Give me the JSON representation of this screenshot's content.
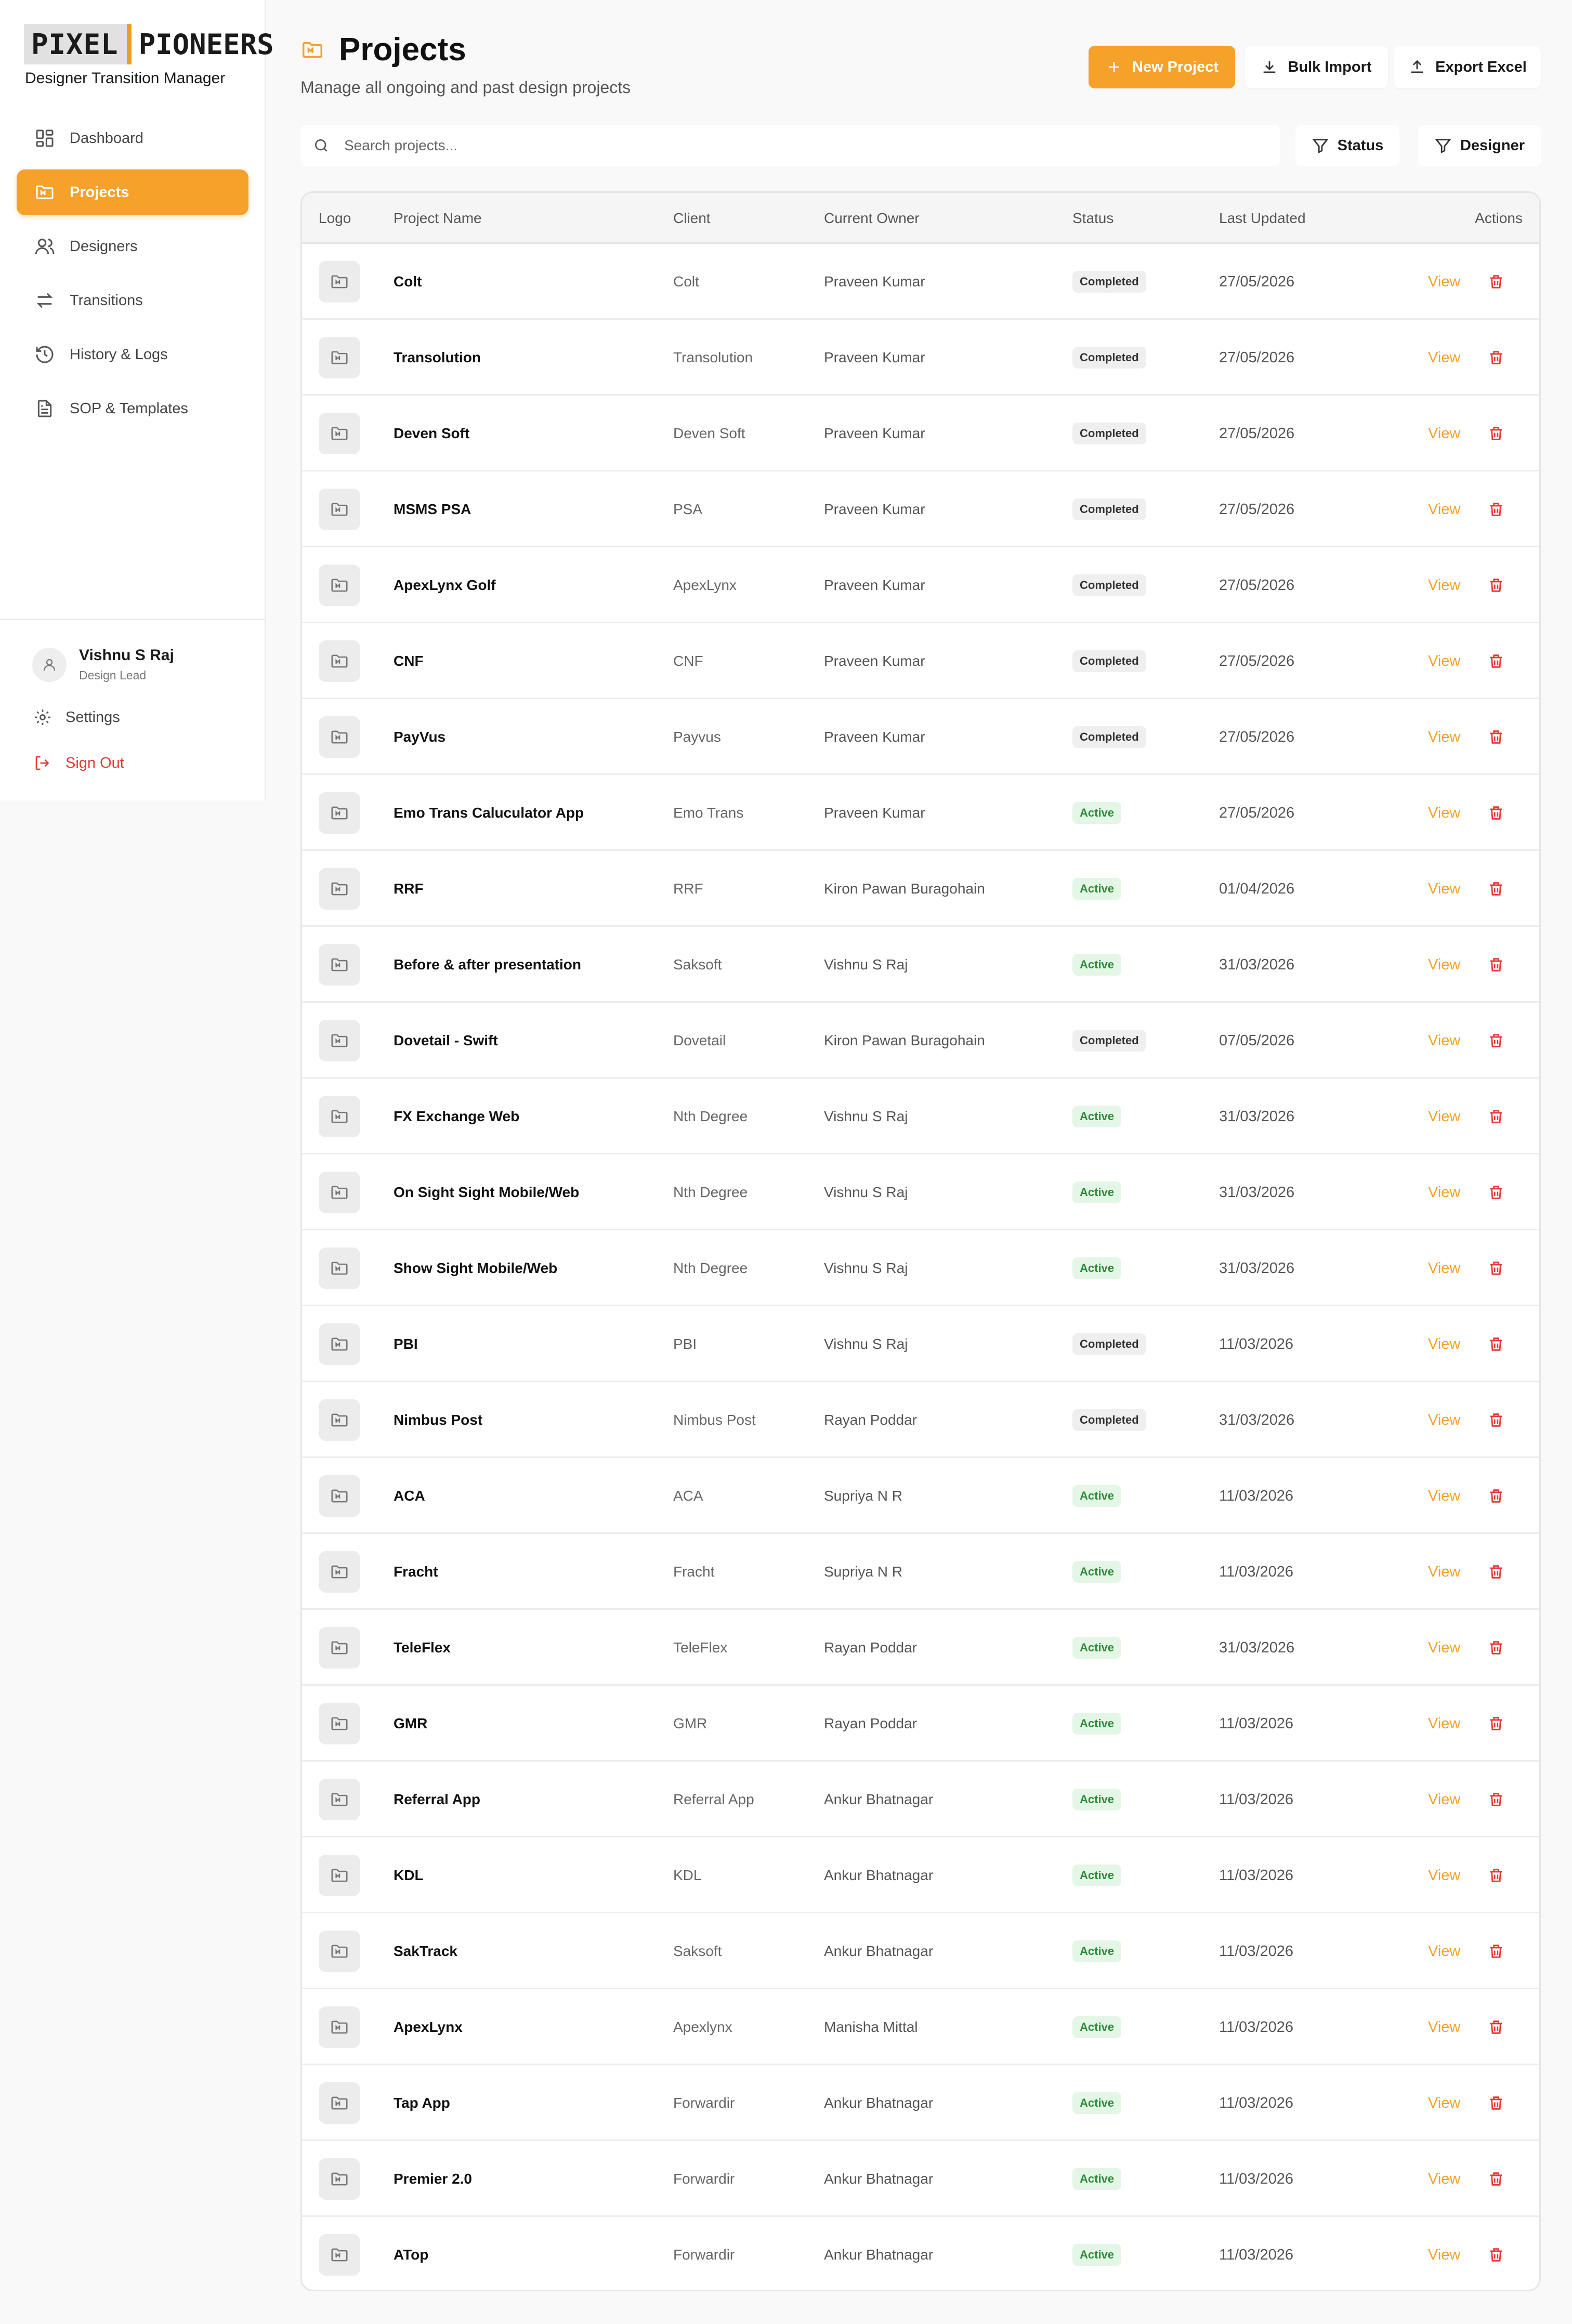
{
  "brand": {
    "logo_part1": "PIXEL",
    "logo_part2": "PIONEERS",
    "app_subtitle": "Designer Transition Manager",
    "accent": "#f5a12a"
  },
  "sidebar": {
    "items": [
      {
        "label": "Dashboard",
        "icon": "dashboard-icon",
        "active": false
      },
      {
        "label": "Projects",
        "icon": "folder-icon",
        "active": true
      },
      {
        "label": "Designers",
        "icon": "users-icon",
        "active": false
      },
      {
        "label": "Transitions",
        "icon": "arrows-icon",
        "active": false
      },
      {
        "label": "History & Logs",
        "icon": "history-icon",
        "active": false
      },
      {
        "label": "SOP & Templates",
        "icon": "document-icon",
        "active": false
      }
    ],
    "user": {
      "name": "Vishnu S Raj",
      "role": "Design Lead"
    },
    "settings_label": "Settings",
    "signout_label": "Sign Out"
  },
  "header": {
    "title": "Projects",
    "subtitle": "Manage all ongoing and past design projects",
    "new_project": "New Project",
    "bulk_import": "Bulk Import",
    "export_excel": "Export Excel"
  },
  "search": {
    "placeholder": "Search projects..."
  },
  "filters": {
    "status": "Status",
    "designer": "Designer"
  },
  "table": {
    "columns": [
      "Logo",
      "Project Name",
      "Client",
      "Current Owner",
      "Status",
      "Last Updated",
      "Actions"
    ],
    "view_label": "View",
    "rows": [
      {
        "name": "Colt",
        "client": "Colt",
        "owner": "Praveen Kumar",
        "status": "Completed",
        "updated": "27/05/2026"
      },
      {
        "name": "Transolution",
        "client": "Transolution",
        "owner": "Praveen Kumar",
        "status": "Completed",
        "updated": "27/05/2026"
      },
      {
        "name": "Deven Soft",
        "client": "Deven Soft",
        "owner": "Praveen Kumar",
        "status": "Completed",
        "updated": "27/05/2026"
      },
      {
        "name": "MSMS PSA",
        "client": "PSA",
        "owner": "Praveen Kumar",
        "status": "Completed",
        "updated": "27/05/2026"
      },
      {
        "name": "ApexLynx Golf",
        "client": "ApexLynx",
        "owner": "Praveen Kumar",
        "status": "Completed",
        "updated": "27/05/2026"
      },
      {
        "name": "CNF",
        "client": "CNF",
        "owner": "Praveen Kumar",
        "status": "Completed",
        "updated": "27/05/2026"
      },
      {
        "name": "PayVus",
        "client": "Payvus",
        "owner": "Praveen Kumar",
        "status": "Completed",
        "updated": "27/05/2026"
      },
      {
        "name": "Emo Trans Caluculator App",
        "client": "Emo Trans",
        "owner": "Praveen Kumar",
        "status": "Active",
        "updated": "27/05/2026"
      },
      {
        "name": "RRF",
        "client": "RRF",
        "owner": "Kiron Pawan Buragohain",
        "status": "Active",
        "updated": "01/04/2026"
      },
      {
        "name": "Before & after presentation",
        "client": "Saksoft",
        "owner": "Vishnu S Raj",
        "status": "Active",
        "updated": "31/03/2026"
      },
      {
        "name": "Dovetail - Swift",
        "client": "Dovetail",
        "owner": "Kiron Pawan Buragohain",
        "status": "Completed",
        "updated": "07/05/2026"
      },
      {
        "name": "FX Exchange Web",
        "client": "Nth Degree",
        "owner": "Vishnu S Raj",
        "status": "Active",
        "updated": "31/03/2026"
      },
      {
        "name": "On Sight Sight Mobile/Web",
        "client": "Nth Degree",
        "owner": "Vishnu S Raj",
        "status": "Active",
        "updated": "31/03/2026"
      },
      {
        "name": "Show Sight Mobile/Web",
        "client": "Nth Degree",
        "owner": "Vishnu S Raj",
        "status": "Active",
        "updated": "31/03/2026"
      },
      {
        "name": "PBI",
        "client": "PBI",
        "owner": "Vishnu S Raj",
        "status": "Completed",
        "updated": "11/03/2026"
      },
      {
        "name": "Nimbus Post",
        "client": "Nimbus Post",
        "owner": "Rayan Poddar",
        "status": "Completed",
        "updated": "31/03/2026"
      },
      {
        "name": "ACA",
        "client": "ACA",
        "owner": "Supriya N R",
        "status": "Active",
        "updated": "11/03/2026"
      },
      {
        "name": "Fracht",
        "client": "Fracht",
        "owner": "Supriya N R",
        "status": "Active",
        "updated": "11/03/2026"
      },
      {
        "name": "TeleFlex",
        "client": "TeleFlex",
        "owner": "Rayan Poddar",
        "status": "Active",
        "updated": "31/03/2026"
      },
      {
        "name": "GMR",
        "client": "GMR",
        "owner": "Rayan Poddar",
        "status": "Active",
        "updated": "11/03/2026"
      },
      {
        "name": "Referral App",
        "client": "Referral App",
        "owner": "Ankur Bhatnagar",
        "status": "Active",
        "updated": "11/03/2026"
      },
      {
        "name": "KDL",
        "client": "KDL",
        "owner": "Ankur Bhatnagar",
        "status": "Active",
        "updated": "11/03/2026"
      },
      {
        "name": "SakTrack",
        "client": "Saksoft",
        "owner": "Ankur Bhatnagar",
        "status": "Active",
        "updated": "11/03/2026"
      },
      {
        "name": "ApexLynx",
        "client": "Apexlynx",
        "owner": "Manisha Mittal",
        "status": "Active",
        "updated": "11/03/2026"
      },
      {
        "name": "Tap App",
        "client": "Forwardir",
        "owner": "Ankur Bhatnagar",
        "status": "Active",
        "updated": "11/03/2026"
      },
      {
        "name": "Premier 2.0",
        "client": "Forwardir",
        "owner": "Ankur Bhatnagar",
        "status": "Active",
        "updated": "11/03/2026"
      },
      {
        "name": "ATop",
        "client": "Forwardir",
        "owner": "Ankur Bhatnagar",
        "status": "Active",
        "updated": "11/03/2026"
      }
    ]
  }
}
